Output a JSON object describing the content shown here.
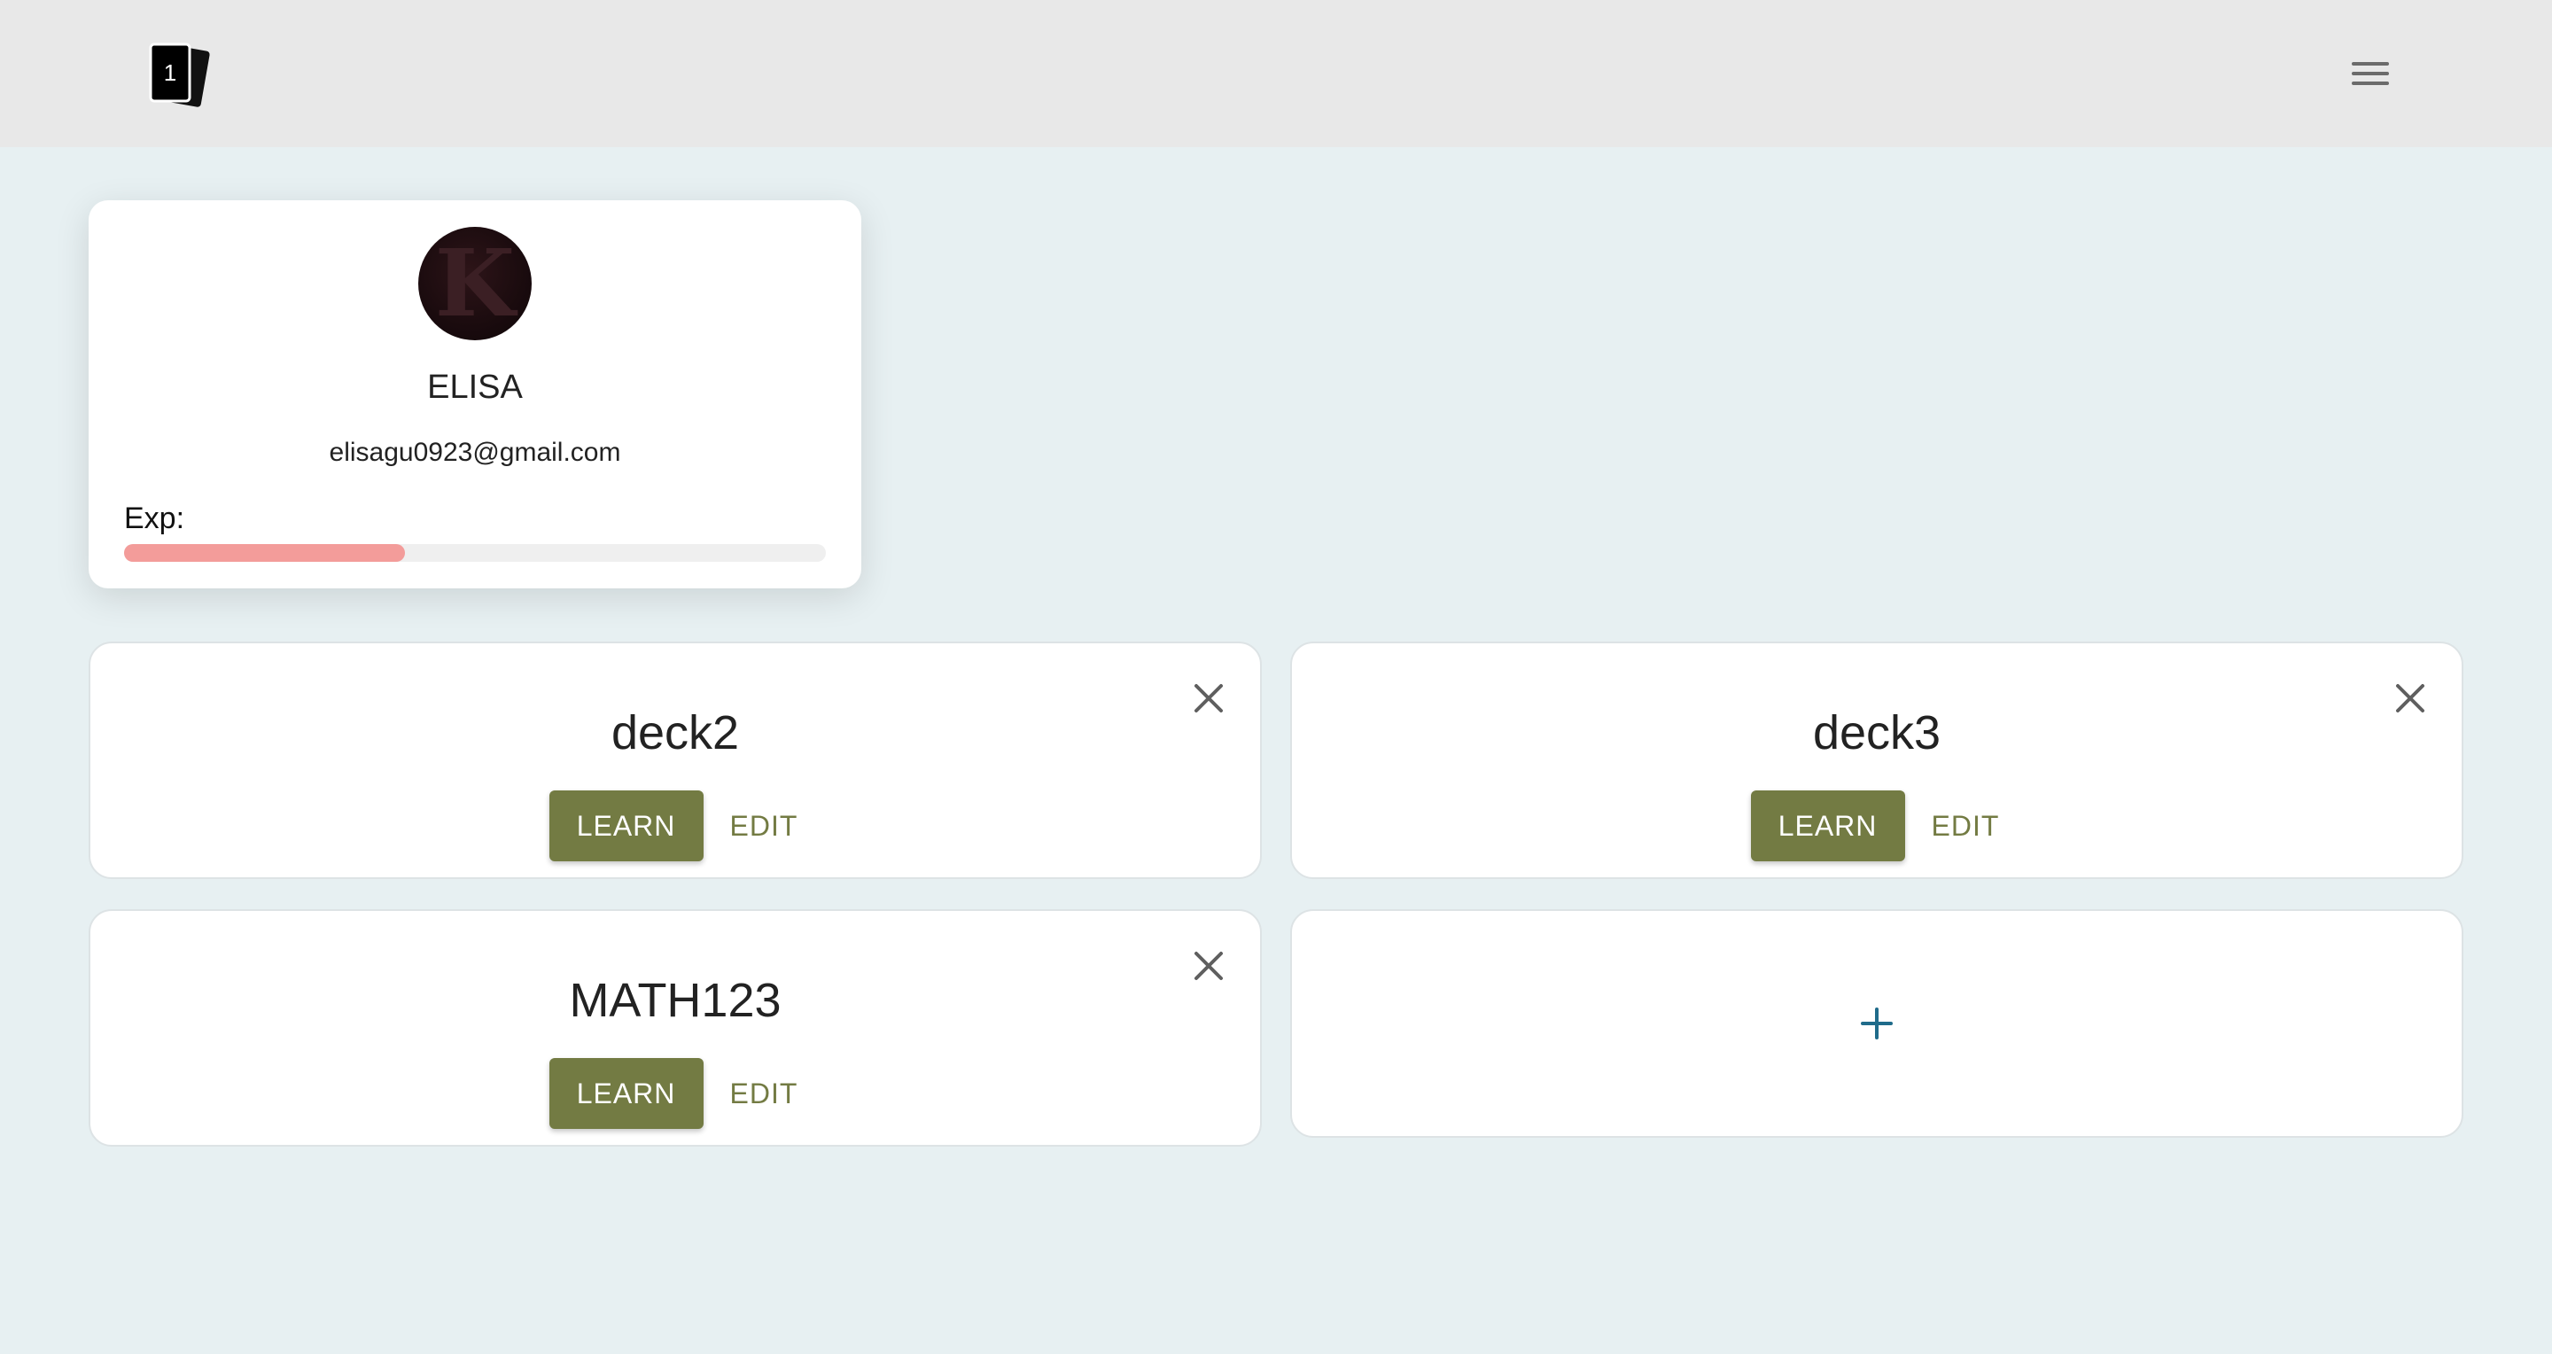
{
  "header": {
    "logo_icon": "cards-logo-icon",
    "logo_number": "1",
    "menu_icon": "hamburger-menu-icon"
  },
  "profile": {
    "avatar_letter": "K",
    "name": "ELISA",
    "email": "elisagu0923@gmail.com",
    "exp_label": "Exp:",
    "exp_progress": 0.4,
    "exp_color": "#f39c9a"
  },
  "decks": [
    {
      "title": "deck2",
      "learn_label": "LEARN",
      "edit_label": "EDIT",
      "close_icon": "close-icon"
    },
    {
      "title": "deck3",
      "learn_label": "LEARN",
      "edit_label": "EDIT",
      "close_icon": "close-icon"
    },
    {
      "title": "MATH123",
      "learn_label": "LEARN",
      "edit_label": "EDIT",
      "close_icon": "close-icon"
    }
  ],
  "add_deck": {
    "icon": "plus-icon"
  },
  "colors": {
    "accent": "#737b43",
    "background": "#e7f0f2",
    "header": "#e8e8e8",
    "plus": "#1f6b8a"
  }
}
